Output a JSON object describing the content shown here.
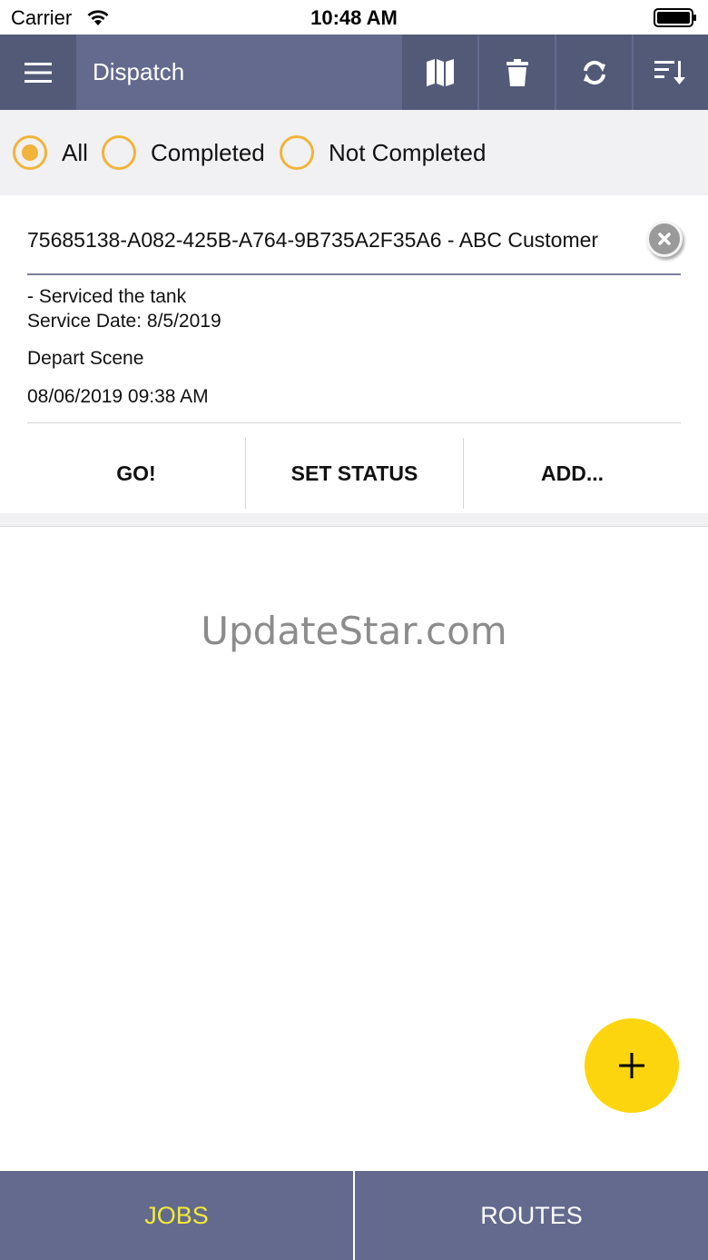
{
  "status_bar": {
    "carrier": "Carrier",
    "time": "10:48 AM",
    "wifi_icon": "wifi-icon",
    "battery_icon": "battery-icon"
  },
  "toolbar": {
    "title": "Dispatch",
    "menu_icon": "hamburger-menu-icon",
    "actions": [
      {
        "icon": "map-icon"
      },
      {
        "icon": "trash-icon"
      },
      {
        "icon": "refresh-icon"
      },
      {
        "icon": "sort-icon"
      }
    ],
    "colors": {
      "bar": "#646a8e",
      "button": "#525a78"
    }
  },
  "filters": {
    "options": [
      "All",
      "Completed",
      "Not Completed"
    ],
    "selected": "All",
    "accent": "#f2b33a"
  },
  "job": {
    "title": "75685138-A082-425B-A764-9B735A2F35A6 - ABC Customer",
    "notes_line1": "- Serviced the tank",
    "notes_line2": "Service Date: 8/5/2019",
    "status": "Depart Scene",
    "status_time": "08/06/2019 09:38 AM",
    "actions": [
      "GO!",
      "SET STATUS",
      "ADD..."
    ]
  },
  "watermark": "UpdateStar.com",
  "fab": {
    "icon": "plus-icon",
    "color": "#fcd50f"
  },
  "tabs": {
    "jobs": "JOBS",
    "routes": "ROUTES",
    "active": "JOBS",
    "active_color": "#f2ea3a"
  }
}
